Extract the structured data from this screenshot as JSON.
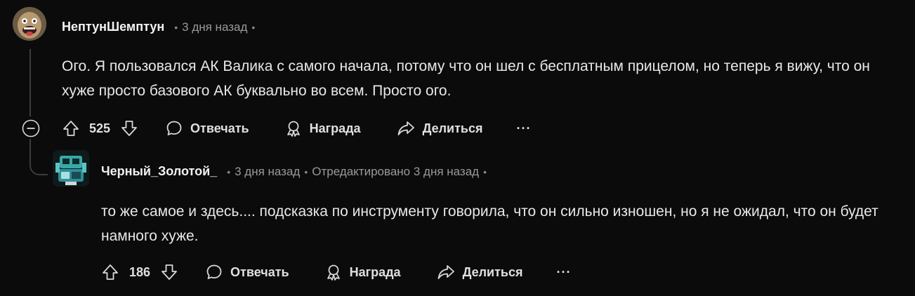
{
  "comments": [
    {
      "author": "НептунШемптун",
      "time": "3 дня назад",
      "text": "Ого. Я пользовался АК Валика с самого начала, потому что он шел с бесплатным прицелом, но теперь я вижу, что он хуже просто базового АК буквально во всем. Просто ого.",
      "upvotes": "525",
      "reply_label": "Отвечать",
      "award_label": "Награда",
      "share_label": "Делиться",
      "more_label": "···"
    },
    {
      "author": "Черный_Золотой_",
      "time": "3 дня назад",
      "edited": "Отредактировано 3 дня назад",
      "text": "то же самое и здесь.... подсказка по инструменту говорила, что он сильно изношен, но я не ожидал, что он будет намного хуже.",
      "upvotes": "186",
      "reply_label": "Отвечать",
      "award_label": "Награда",
      "share_label": "Делиться",
      "more_label": "···"
    }
  ],
  "colors": {
    "background": "#0b0b0b",
    "text": "#e8e8e8",
    "muted": "#9a9a9a",
    "thread_line": "#3c3c3c"
  }
}
